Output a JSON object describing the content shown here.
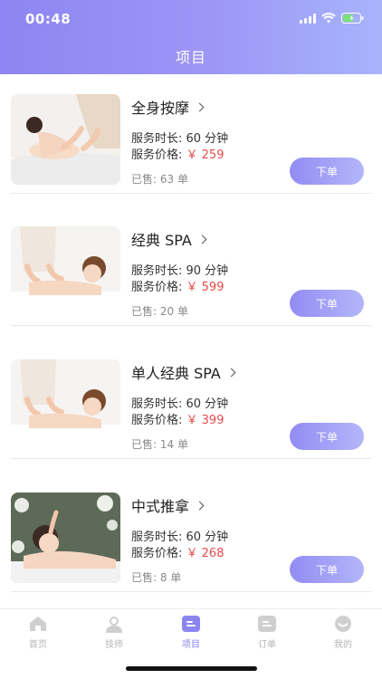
{
  "status_bar": {
    "time": "00:48"
  },
  "header": {
    "title": "项目"
  },
  "colors": {
    "accent": "#8d86f2",
    "price": "#e64b4b"
  },
  "items": [
    {
      "name": "全身按摩",
      "duration_label": "服务时长: 60 分钟",
      "price_label": "服务价格:",
      "price": "￥ 259",
      "sold": "已售: 63 单",
      "order_label": "下单",
      "image": "full-body-massage-photo"
    },
    {
      "name": "经典 SPA",
      "duration_label": "服务时长: 90 分钟",
      "price_label": "服务价格:",
      "price": "￥ 599",
      "sold": "已售: 20 单",
      "order_label": "下单",
      "image": "classic-spa-photo"
    },
    {
      "name": "单人经典 SPA",
      "duration_label": "服务时长: 60 分钟",
      "price_label": "服务价格:",
      "price": "￥ 399",
      "sold": "已售: 14 单",
      "order_label": "下单",
      "image": "single-classic-spa-photo"
    },
    {
      "name": "中式推拿",
      "duration_label": "服务时长: 60 分钟",
      "price_label": "服务价格:",
      "price": "￥ 268",
      "sold": "已售: 8 单",
      "order_label": "下单",
      "image": "chinese-tuina-photo"
    }
  ],
  "tabbar": [
    {
      "label": "首页",
      "icon": "home-icon"
    },
    {
      "label": "技师",
      "icon": "technician-icon"
    },
    {
      "label": "项目",
      "icon": "project-icon",
      "active": true
    },
    {
      "label": "订单",
      "icon": "order-icon"
    },
    {
      "label": "我的",
      "icon": "profile-icon"
    }
  ]
}
